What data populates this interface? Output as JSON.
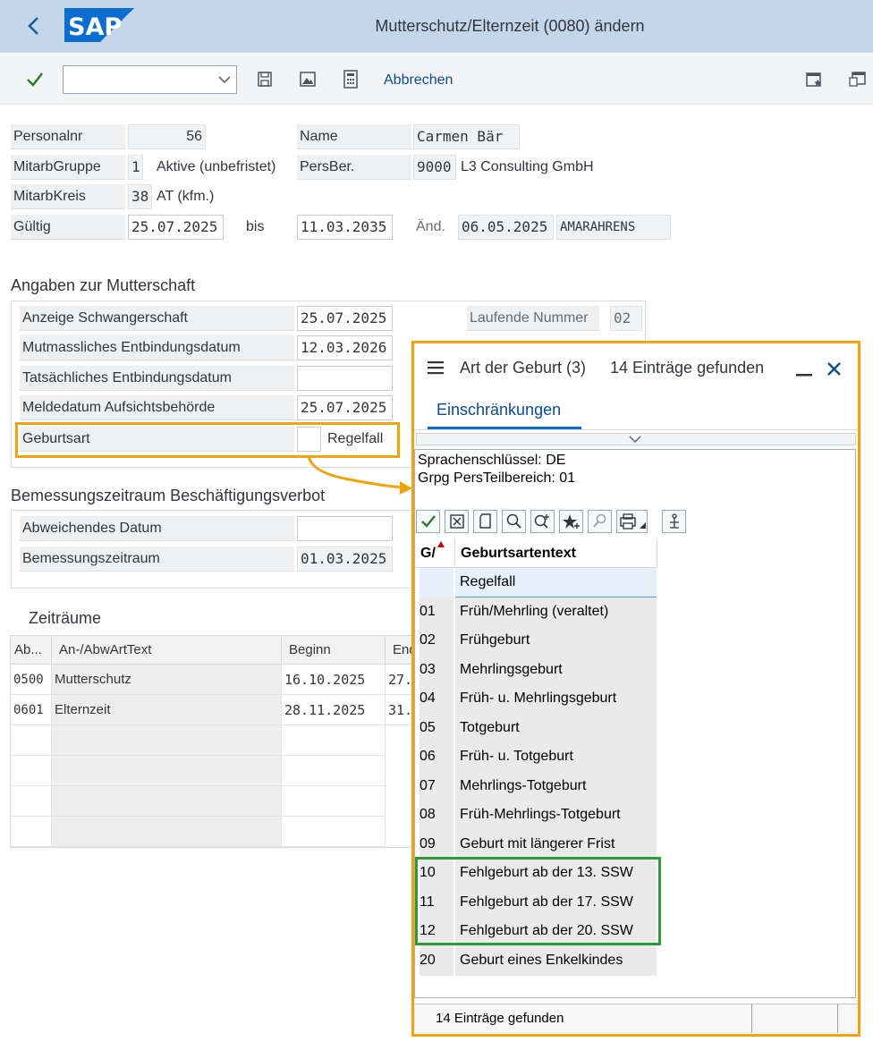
{
  "window": {
    "title": "Mutterschutz/Elternzeit (0080) ändern"
  },
  "toolbar": {
    "cancel_label": "Abbrechen",
    "command_value": ""
  },
  "header": {
    "personalnr_label": "Personalnr",
    "personalnr_value": "56",
    "name_label": "Name",
    "name_value": "Carmen Bär",
    "mitarbgruppe_label": "MitarbGruppe",
    "mitarbgruppe_code": "1",
    "mitarbgruppe_text": "Aktive (unbefristet)",
    "persber_label": "PersBer.",
    "persber_code": "9000",
    "persber_text": "L3 Consulting GmbH",
    "mitarbkreis_label": "MitarbKreis",
    "mitarbkreis_code": "38",
    "mitarbkreis_text": "AT (kfm.)",
    "gueltig_label": "Gültig",
    "gueltig_from": "25.07.2025",
    "bis_label": "bis",
    "gueltig_to": "11.03.2035",
    "aend_label": "Änd.",
    "aend_date": "06.05.2025",
    "aend_user": "AMARAHRENS"
  },
  "mutterschaft": {
    "title": "Angaben zur Mutterschaft",
    "anzeige_label": "Anzeige Schwangerschaft",
    "anzeige_value": "25.07.2025",
    "lfd_label": "Laufende Nummer",
    "lfd_value": "02",
    "mutmass_label": "Mutmassliches Entbindungsdatum",
    "mutmass_value": "12.03.2026",
    "tatsaechl_label": "Tatsächliches Entbindungsdatum",
    "tatsaechl_value": "",
    "melde_label": "Meldedatum Aufsichtsbehörde",
    "melde_value": "25.07.2025",
    "geburtsart_label": "Geburtsart",
    "geburtsart_value": "",
    "geburtsart_text": "Regelfall"
  },
  "bemessung": {
    "title": "Bemessungszeitraum Beschäftigungsverbot",
    "abw_label": "Abweichendes Datum",
    "abw_value": "",
    "zeitraum_label": "Bemessungszeitraum",
    "zeitraum_value": "01.03.2025"
  },
  "zeitraeume": {
    "title": "Zeiträume",
    "columns": [
      "Ab...",
      "An-/AbwArtText",
      "Beginn",
      "End"
    ],
    "rows": [
      {
        "art": "0500",
        "text": "Mutterschutz",
        "beginn": "16.10.2025",
        "ende": "27."
      },
      {
        "art": "0601",
        "text": "Elternzeit",
        "beginn": "28.11.2025",
        "ende": "31."
      }
    ]
  },
  "popup": {
    "title": "Art der Geburt (3)",
    "count_text": "14 Einträge gefunden",
    "tab_label": "Einschränkungen",
    "restriction_1": "Sprachenschlüssel: DE",
    "restriction_2": "Grpg PersTeilbereich: 01",
    "col_key": "G/",
    "col_text": "Geburtsartentext",
    "footer_text": "14 Einträge gefunden",
    "items": [
      {
        "key": "",
        "text": "Regelfall"
      },
      {
        "key": "01",
        "text": "Früh/Mehrling (veraltet)"
      },
      {
        "key": "02",
        "text": "Frühgeburt"
      },
      {
        "key": "03",
        "text": "Mehrlingsgeburt"
      },
      {
        "key": "04",
        "text": "Früh- u. Mehrlingsgeburt"
      },
      {
        "key": "05",
        "text": "Totgeburt"
      },
      {
        "key": "06",
        "text": "Früh- u. Totgeburt"
      },
      {
        "key": "07",
        "text": "Mehrlings-Totgeburt"
      },
      {
        "key": "08",
        "text": "Früh-Mehrlings-Totgeburt"
      },
      {
        "key": "09",
        "text": "Geburt mit längerer Frist"
      },
      {
        "key": "10",
        "text": "Fehlgeburt ab der 13. SSW"
      },
      {
        "key": "11",
        "text": "Fehlgeburt ab der 17. SSW"
      },
      {
        "key": "12",
        "text": "Fehlgeburt ab der 20. SSW"
      },
      {
        "key": "20",
        "text": "Geburt eines Enkelkindes"
      }
    ]
  },
  "colors": {
    "titlebar": "#c3d6ea",
    "sap_blue": "#0a6ed1",
    "highlight_orange": "#f0a30a",
    "highlight_green": "#2e9a35",
    "check_green": "#2b7d2b"
  },
  "icons": [
    "back-icon",
    "sap-logo",
    "check-icon",
    "dropdown-icon",
    "save-icon",
    "image-icon",
    "calculator-icon",
    "window-new-icon",
    "window-icon",
    "menu-icon",
    "minimize-icon",
    "close-icon"
  ]
}
